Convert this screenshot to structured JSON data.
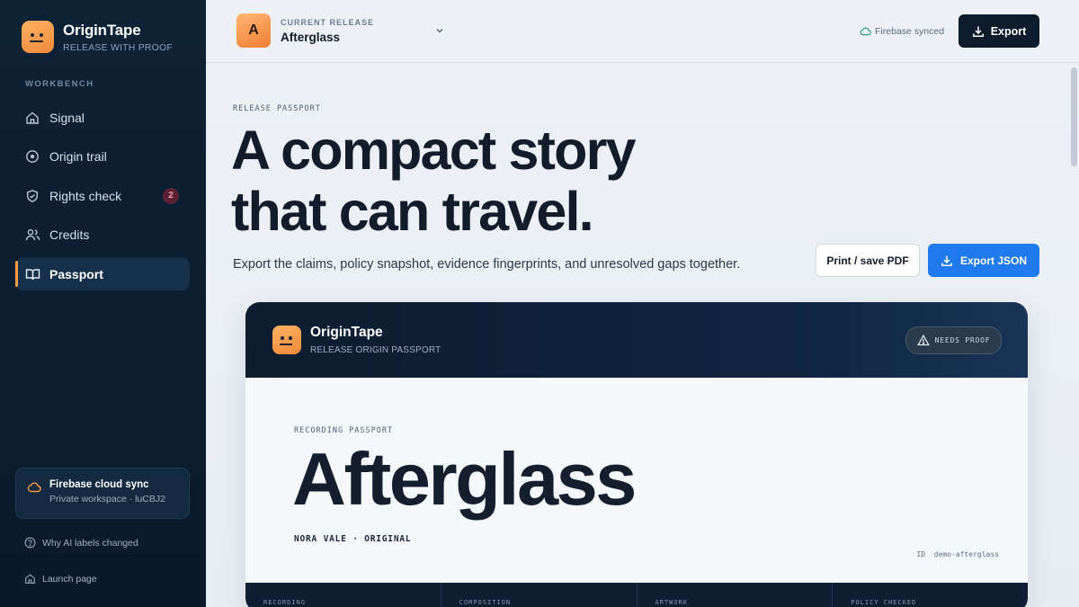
{
  "sidebar": {
    "brand": {
      "name": "OriginTape",
      "tagline": "RELEASE WITH PROOF"
    },
    "section_label": "WORKBENCH",
    "items": [
      {
        "label": "Signal",
        "icon": "home-icon"
      },
      {
        "label": "Origin trail",
        "icon": "target-icon"
      },
      {
        "label": "Rights check",
        "icon": "shield-icon",
        "badge": "2"
      },
      {
        "label": "Credits",
        "icon": "users-icon"
      },
      {
        "label": "Passport",
        "icon": "book-icon",
        "active": true
      }
    ],
    "sync_card": {
      "title": "Firebase cloud sync",
      "subtitle": "Private workspace · luCBJ2",
      "icon": "cloud-icon"
    },
    "footer_links": [
      {
        "label": "Why AI labels changed",
        "icon": "help-icon"
      },
      {
        "label": "Launch page",
        "icon": "home-icon"
      }
    ]
  },
  "topbar": {
    "release_initial": "A",
    "release_label": "CURRENT RELEASE",
    "release_name": "Afterglass",
    "sync_status": "Firebase synced",
    "export_label": "Export"
  },
  "main": {
    "eyebrow": "RELEASE PASSPORT",
    "headline_line1": "A compact story",
    "headline_line2": "that can travel.",
    "subline": "Export the claims, policy snapshot, evidence fingerprints, and unresolved gaps together.",
    "print_label": "Print / save PDF",
    "json_label": "Export JSON"
  },
  "passport": {
    "brand": "OriginTape",
    "subtitle": "RELEASE ORIGIN PASSPORT",
    "status": "NEEDS PROOF",
    "rec_label": "RECORDING PASSPORT",
    "title": "Afterglass",
    "artist": "NORA VALE · ORIGINAL",
    "id_label": "ID",
    "id_value": "demo-afterglass",
    "footer_cols": [
      "RECORDING",
      "COMPOSITION",
      "ARTWORK",
      "POLICY CHECKED"
    ]
  },
  "colors": {
    "accent": "#f39a45",
    "primary": "#1f7aed",
    "dark": "#0e1b2a"
  }
}
